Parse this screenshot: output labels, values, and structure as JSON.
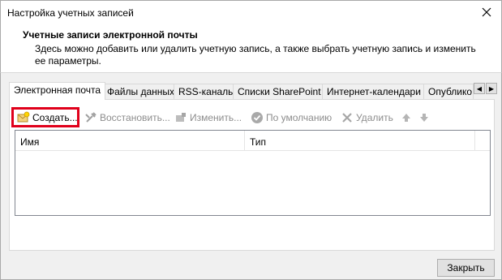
{
  "window": {
    "title": "Настройка учетных записей"
  },
  "header": {
    "heading": "Учетные записи электронной почты",
    "description": "Здесь можно добавить или удалить учетную запись, а также выбрать учетную запись и изменить ее параметры."
  },
  "tabs": [
    {
      "label": "Электронная почта",
      "active": true
    },
    {
      "label": "Файлы данных"
    },
    {
      "label": "RSS-каналы"
    },
    {
      "label": "Списки SharePoint"
    },
    {
      "label": "Интернет-календари"
    },
    {
      "label": "Опублико"
    }
  ],
  "toolbar": {
    "create_label": "Создать...",
    "restore_label": "Восстановить...",
    "change_label": "Изменить...",
    "default_label": "По умолчанию",
    "delete_label": "Удалить"
  },
  "list": {
    "columns": [
      "Имя",
      "Тип"
    ],
    "rows": []
  },
  "footer": {
    "close_label": "Закрыть"
  },
  "colors": {
    "highlight": "#e0001b",
    "disabled_text": "#8d8d8d"
  }
}
